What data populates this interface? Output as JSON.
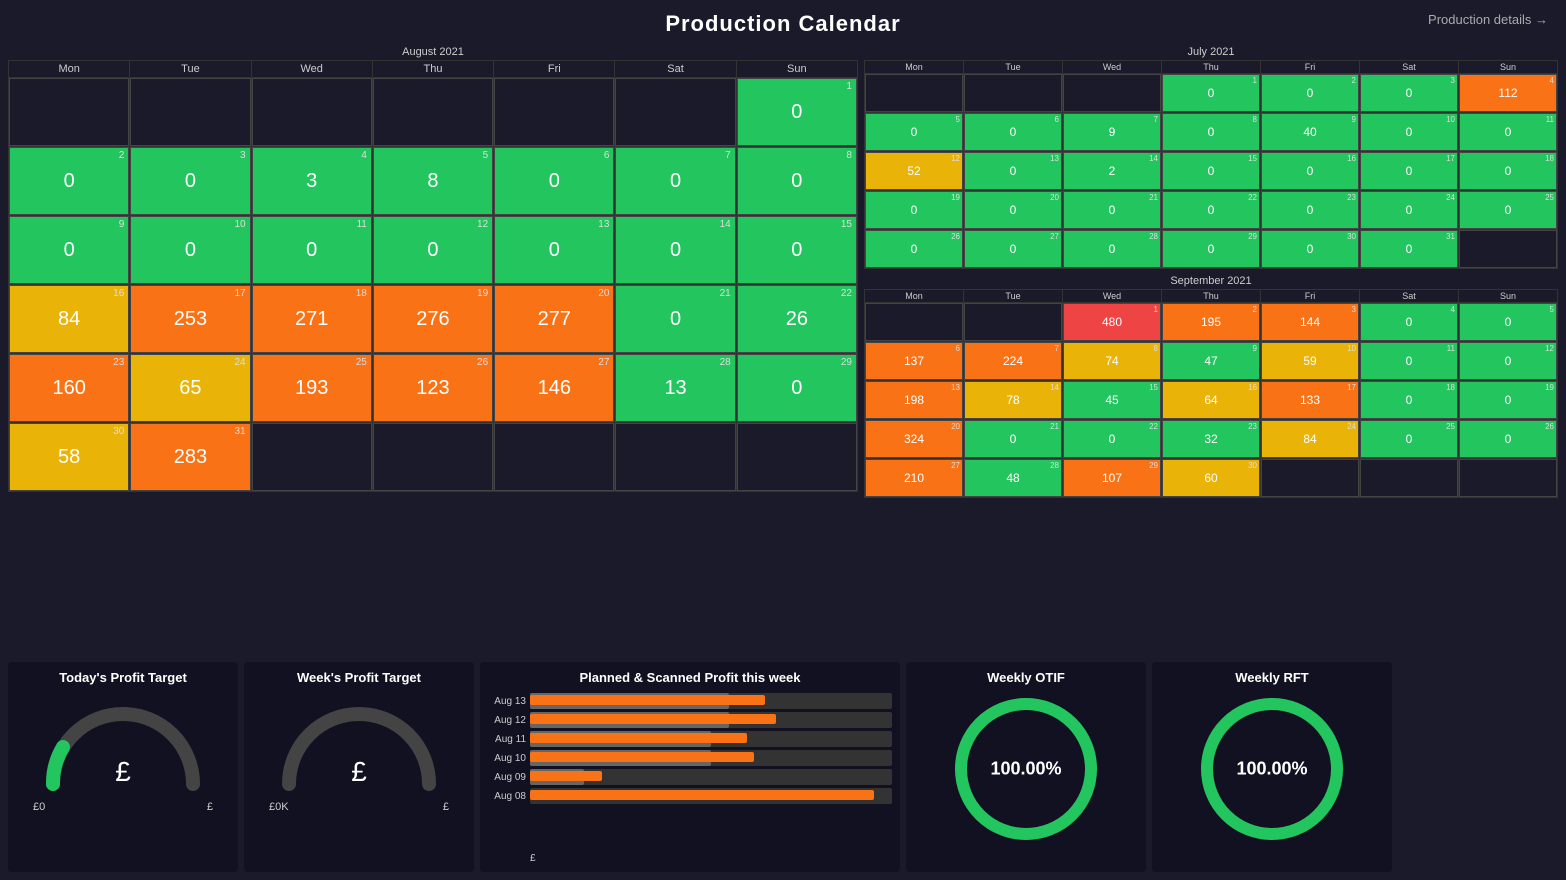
{
  "header": {
    "title": "Production Calendar",
    "details_link": "Production details →"
  },
  "august2021": {
    "title": "August 2021",
    "days": [
      "Mon",
      "Tue",
      "Wed",
      "Thu",
      "Fri",
      "Sat",
      "Sun"
    ],
    "rows": [
      [
        {
          "num": null,
          "val": null,
          "color": "empty"
        },
        {
          "num": null,
          "val": null,
          "color": "empty"
        },
        {
          "num": null,
          "val": null,
          "color": "empty"
        },
        {
          "num": null,
          "val": null,
          "color": "empty"
        },
        {
          "num": null,
          "val": null,
          "color": "empty"
        },
        {
          "num": null,
          "val": null,
          "color": "empty"
        },
        {
          "num": 1,
          "val": "0",
          "color": "green"
        }
      ],
      [
        {
          "num": 2,
          "val": "0",
          "color": "green"
        },
        {
          "num": 3,
          "val": "0",
          "color": "green"
        },
        {
          "num": 4,
          "val": "3",
          "color": "green"
        },
        {
          "num": 5,
          "val": "8",
          "color": "green"
        },
        {
          "num": 6,
          "val": "0",
          "color": "green"
        },
        {
          "num": 7,
          "val": "0",
          "color": "green"
        },
        {
          "num": 8,
          "val": "0",
          "color": "green"
        }
      ],
      [
        {
          "num": 9,
          "val": "0",
          "color": "green"
        },
        {
          "num": 10,
          "val": "0",
          "color": "green"
        },
        {
          "num": 11,
          "val": "0",
          "color": "green"
        },
        {
          "num": 12,
          "val": "0",
          "color": "green"
        },
        {
          "num": 13,
          "val": "0",
          "color": "green"
        },
        {
          "num": 14,
          "val": "0",
          "color": "green"
        },
        {
          "num": 15,
          "val": "0",
          "color": "green"
        }
      ],
      [
        {
          "num": 16,
          "val": "84",
          "color": "yellow"
        },
        {
          "num": 17,
          "val": "253",
          "color": "orange"
        },
        {
          "num": 18,
          "val": "271",
          "color": "orange"
        },
        {
          "num": 19,
          "val": "276",
          "color": "orange"
        },
        {
          "num": 20,
          "val": "277",
          "color": "orange"
        },
        {
          "num": 21,
          "val": "0",
          "color": "green"
        },
        {
          "num": 22,
          "val": "26",
          "color": "green"
        }
      ],
      [
        {
          "num": 23,
          "val": "160",
          "color": "orange"
        },
        {
          "num": 24,
          "val": "65",
          "color": "yellow"
        },
        {
          "num": 25,
          "val": "193",
          "color": "orange"
        },
        {
          "num": 26,
          "val": "123",
          "color": "orange"
        },
        {
          "num": 27,
          "val": "146",
          "color": "orange"
        },
        {
          "num": 28,
          "val": "13",
          "color": "green"
        },
        {
          "num": 29,
          "val": "0",
          "color": "green"
        }
      ],
      [
        {
          "num": 30,
          "val": "58",
          "color": "yellow"
        },
        {
          "num": 31,
          "val": "283",
          "color": "orange"
        },
        {
          "num": null,
          "val": null,
          "color": "empty"
        },
        {
          "num": null,
          "val": null,
          "color": "empty"
        },
        {
          "num": null,
          "val": null,
          "color": "empty"
        },
        {
          "num": null,
          "val": null,
          "color": "empty"
        },
        {
          "num": null,
          "val": null,
          "color": "empty"
        }
      ]
    ]
  },
  "july2021": {
    "title": "July 2021",
    "days": [
      "Mon",
      "Tue",
      "Wed",
      "Thu",
      "Fri",
      "Sat",
      "Sun"
    ],
    "rows": [
      [
        {
          "num": null,
          "val": null,
          "color": "empty"
        },
        {
          "num": null,
          "val": null,
          "color": "empty"
        },
        {
          "num": null,
          "val": null,
          "color": "empty"
        },
        {
          "num": 1,
          "val": "0",
          "color": "green"
        },
        {
          "num": 2,
          "val": "0",
          "color": "green"
        },
        {
          "num": 3,
          "val": "0",
          "color": "green"
        },
        {
          "num": 4,
          "val": "112",
          "color": "orange"
        }
      ],
      [
        {
          "num": 5,
          "val": "0",
          "color": "green"
        },
        {
          "num": 6,
          "val": "0",
          "color": "green"
        },
        {
          "num": 7,
          "val": "9",
          "color": "green"
        },
        {
          "num": 8,
          "val": "0",
          "color": "green"
        },
        {
          "num": 9,
          "val": "40",
          "color": "green"
        },
        {
          "num": 10,
          "val": "0",
          "color": "green"
        },
        {
          "num": 11,
          "val": "0",
          "color": "green"
        }
      ],
      [
        {
          "num": 12,
          "val": "52",
          "color": "yellow"
        },
        {
          "num": 13,
          "val": "0",
          "color": "green"
        },
        {
          "num": 14,
          "val": "2",
          "color": "green"
        },
        {
          "num": 15,
          "val": "0",
          "color": "green"
        },
        {
          "num": 16,
          "val": "0",
          "color": "green"
        },
        {
          "num": 17,
          "val": "0",
          "color": "green"
        },
        {
          "num": 18,
          "val": "0",
          "color": "green"
        }
      ],
      [
        {
          "num": 19,
          "val": "0",
          "color": "green"
        },
        {
          "num": 20,
          "val": "0",
          "color": "green"
        },
        {
          "num": 21,
          "val": "0",
          "color": "green"
        },
        {
          "num": 22,
          "val": "0",
          "color": "green"
        },
        {
          "num": 23,
          "val": "0",
          "color": "green"
        },
        {
          "num": 24,
          "val": "0",
          "color": "green"
        },
        {
          "num": 25,
          "val": "0",
          "color": "green"
        }
      ],
      [
        {
          "num": 26,
          "val": "0",
          "color": "green"
        },
        {
          "num": 27,
          "val": "0",
          "color": "green"
        },
        {
          "num": 28,
          "val": "0",
          "color": "green"
        },
        {
          "num": 29,
          "val": "0",
          "color": "green"
        },
        {
          "num": 30,
          "val": "0",
          "color": "green"
        },
        {
          "num": 31,
          "val": "0",
          "color": "green"
        },
        {
          "num": null,
          "val": null,
          "color": "empty"
        }
      ]
    ]
  },
  "september2021": {
    "title": "September 2021",
    "days": [
      "Mon",
      "Tue",
      "Wed",
      "Thu",
      "Fri",
      "Sat",
      "Sun"
    ],
    "rows": [
      [
        {
          "num": null,
          "val": null,
          "color": "empty"
        },
        {
          "num": null,
          "val": null,
          "color": "empty"
        },
        {
          "num": 1,
          "val": "480",
          "color": "red"
        },
        {
          "num": 2,
          "val": "195",
          "color": "orange"
        },
        {
          "num": 3,
          "val": "144",
          "color": "orange"
        },
        {
          "num": 4,
          "val": "0",
          "color": "green"
        },
        {
          "num": 5,
          "val": "0",
          "color": "green"
        }
      ],
      [
        {
          "num": 6,
          "val": "137",
          "color": "orange"
        },
        {
          "num": 7,
          "val": "224",
          "color": "orange"
        },
        {
          "num": 8,
          "val": "74",
          "color": "yellow"
        },
        {
          "num": 9,
          "val": "47",
          "color": "green"
        },
        {
          "num": 10,
          "val": "59",
          "color": "yellow"
        },
        {
          "num": 11,
          "val": "0",
          "color": "green"
        },
        {
          "num": 12,
          "val": "0",
          "color": "green"
        }
      ],
      [
        {
          "num": 13,
          "val": "198",
          "color": "orange"
        },
        {
          "num": 14,
          "val": "78",
          "color": "yellow"
        },
        {
          "num": 15,
          "val": "45",
          "color": "green"
        },
        {
          "num": 16,
          "val": "64",
          "color": "yellow"
        },
        {
          "num": 17,
          "val": "133",
          "color": "orange"
        },
        {
          "num": 18,
          "val": "0",
          "color": "green"
        },
        {
          "num": 19,
          "val": "0",
          "color": "green"
        }
      ],
      [
        {
          "num": 20,
          "val": "324",
          "color": "orange"
        },
        {
          "num": 21,
          "val": "0",
          "color": "green"
        },
        {
          "num": 22,
          "val": "0",
          "color": "green"
        },
        {
          "num": 23,
          "val": "32",
          "color": "green"
        },
        {
          "num": 24,
          "val": "84",
          "color": "yellow"
        },
        {
          "num": 25,
          "val": "0",
          "color": "green"
        },
        {
          "num": 26,
          "val": "0",
          "color": "green"
        }
      ],
      [
        {
          "num": 27,
          "val": "210",
          "color": "orange"
        },
        {
          "num": 28,
          "val": "48",
          "color": "green"
        },
        {
          "num": 29,
          "val": "107",
          "color": "orange"
        },
        {
          "num": 30,
          "val": "60",
          "color": "yellow"
        },
        {
          "num": null,
          "val": null,
          "color": "empty"
        },
        {
          "num": null,
          "val": null,
          "color": "empty"
        },
        {
          "num": null,
          "val": null,
          "color": "empty"
        }
      ]
    ]
  },
  "bottomWidgets": {
    "todayProfit": {
      "title": "Today's Profit Target",
      "value": "£",
      "min": "£0",
      "max": "£"
    },
    "weekProfit": {
      "title": "Week's Profit Target",
      "value": "£",
      "min": "£0K",
      "max": "£"
    },
    "plannedScanned": {
      "title": "Planned & Scanned Profit this week",
      "rows": [
        {
          "label": "Aug 13",
          "planned": 65,
          "scanned": 55
        },
        {
          "label": "Aug 12",
          "planned": 68,
          "scanned": 55
        },
        {
          "label": "Aug 11",
          "planned": 60,
          "scanned": 50
        },
        {
          "label": "Aug 10",
          "planned": 62,
          "scanned": 50
        },
        {
          "label": "Aug 09",
          "planned": 20,
          "scanned": 15
        },
        {
          "label": "Aug 08",
          "planned": 95,
          "scanned": 0
        }
      ],
      "footer": "£"
    },
    "weeklyOTIF": {
      "title": "Weekly OTIF",
      "value": "100.00%"
    },
    "weeklyRFT": {
      "title": "Weekly RFT",
      "value": "100.00%"
    }
  }
}
